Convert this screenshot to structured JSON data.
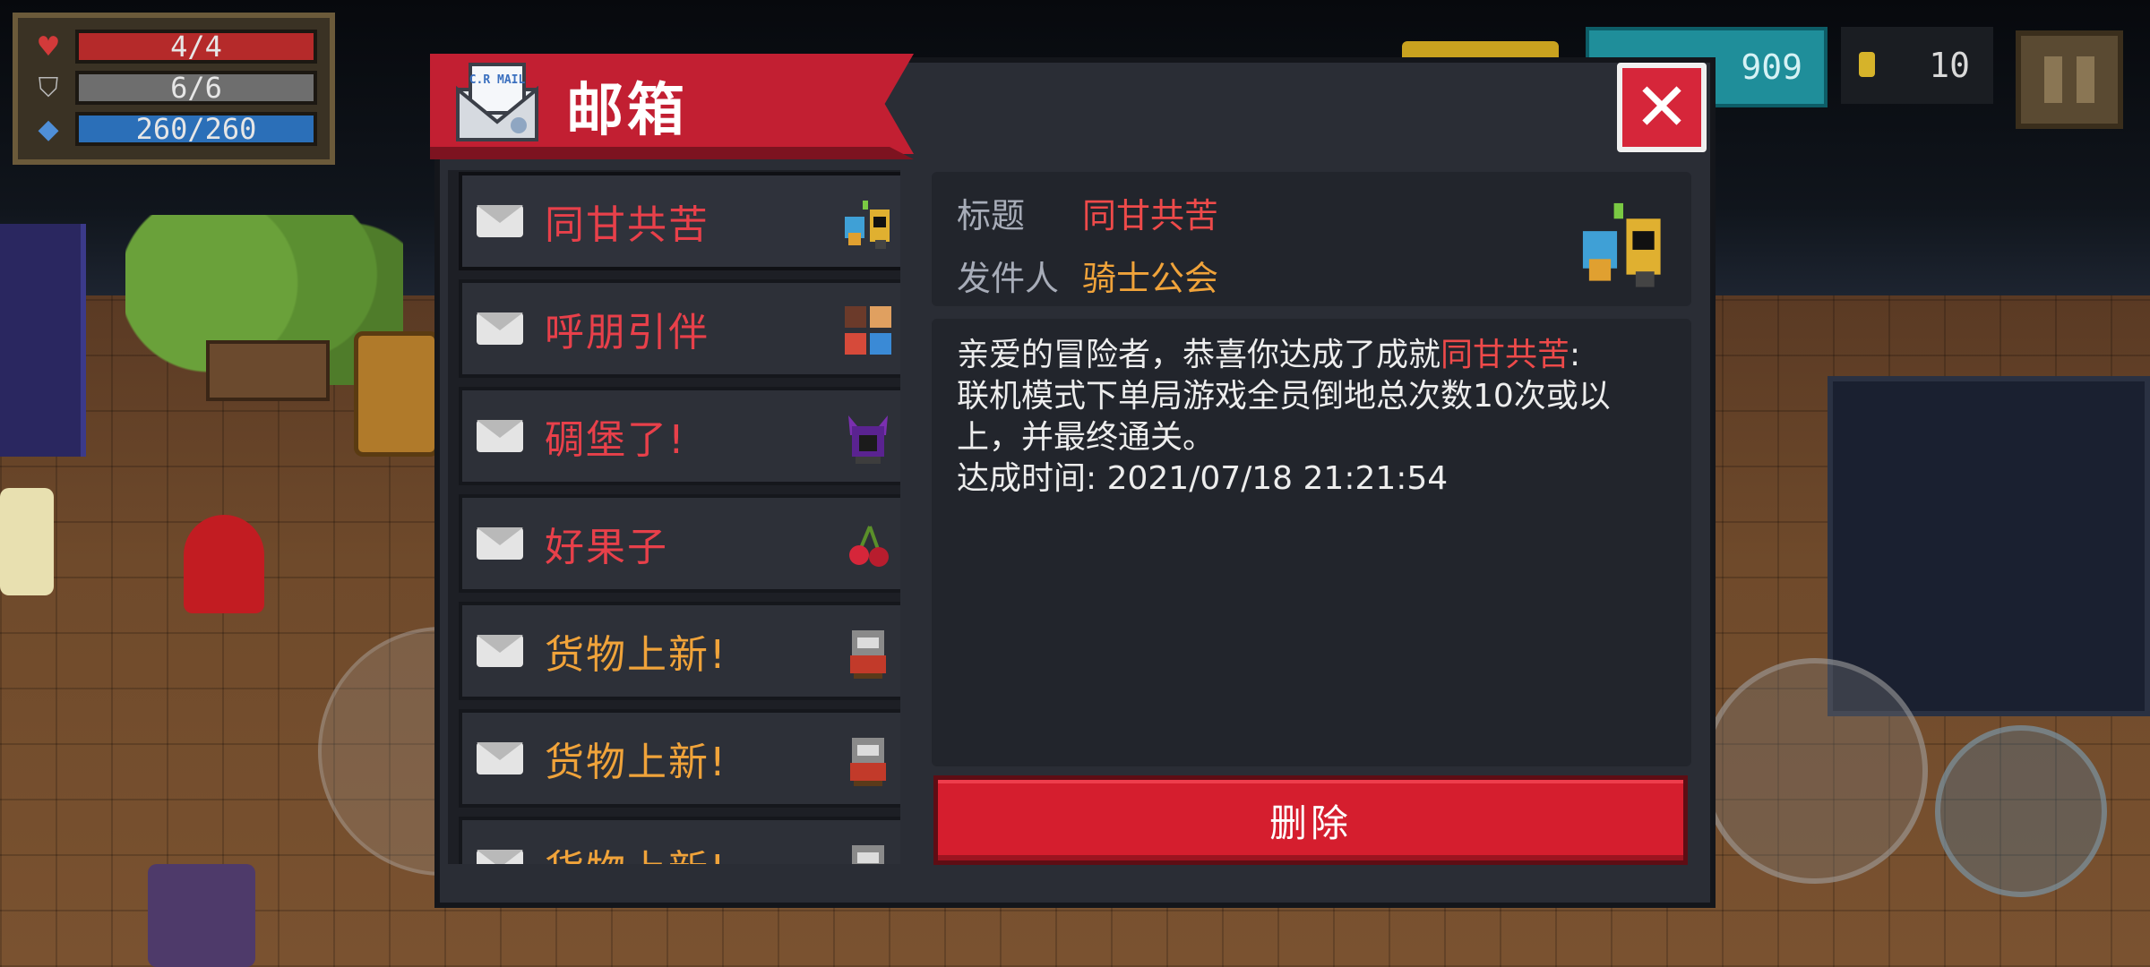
{
  "hud": {
    "hp": "4/4",
    "armor": "6/6",
    "energy": "260/260",
    "gems": "909",
    "coins": "10"
  },
  "mailbox": {
    "title": "邮箱",
    "logo_text": "C.R MAIL",
    "items": [
      {
        "subject": "同甘共苦",
        "color": "red",
        "icon": "knight-wizard-icon"
      },
      {
        "subject": "呼朋引伴",
        "color": "red",
        "icon": "friends-group-icon"
      },
      {
        "subject": "碉堡了!",
        "color": "red",
        "icon": "purple-demon-icon"
      },
      {
        "subject": "好果子",
        "color": "red",
        "icon": "cherry-icon"
      },
      {
        "subject": "货物上新!",
        "color": "orange",
        "icon": "merchant-icon"
      },
      {
        "subject": "货物上新!",
        "color": "orange",
        "icon": "merchant-icon"
      },
      {
        "subject": "货物上新!",
        "color": "orange",
        "icon": "merchant-icon"
      }
    ],
    "detail": {
      "title_label": "标题",
      "title_value": "同甘共苦",
      "sender_label": "发件人",
      "sender_value": "骑士公会",
      "body_prefix": "亲爱的冒险者，恭喜你达成了成就",
      "body_achievement": "同甘共苦",
      "body_colon": ":",
      "body_line2": "联机模式下单局游戏全员倒地总次数10次或以上，并最终通关。",
      "body_time": "达成时间: 2021/07/18 21:21:54",
      "delete_label": "删除"
    }
  },
  "colors": {
    "accent_red": "#c21f32",
    "subject_red": "#e8404a",
    "subject_orange": "#f0a33a",
    "panel": "#2a2d35"
  }
}
